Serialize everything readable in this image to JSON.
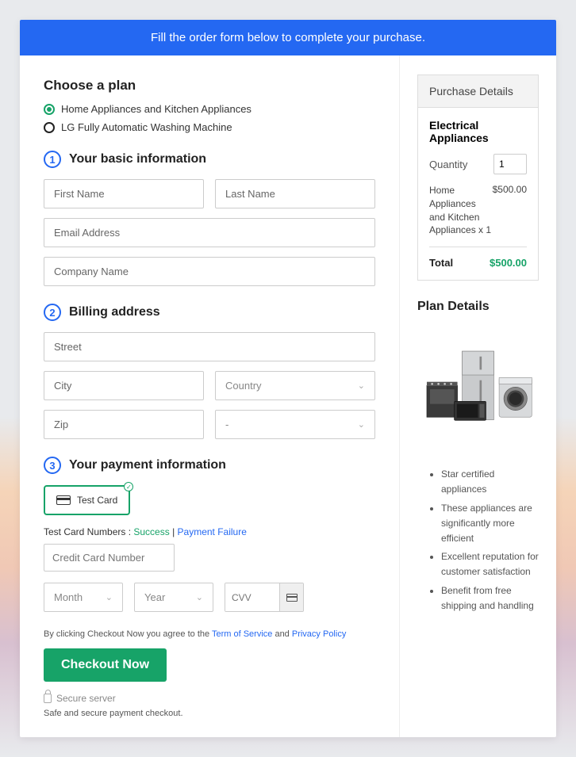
{
  "header": {
    "banner": "Fill the order form below to complete your purchase."
  },
  "plan": {
    "title": "Choose a plan",
    "option1": "Home Appliances and Kitchen Appliances",
    "option2": "LG Fully Automatic Washing Machine"
  },
  "step1": {
    "num": "1",
    "title": "Your basic information",
    "first_name_ph": "First Name",
    "last_name_ph": "Last Name",
    "email_ph": "Email Address",
    "company_ph": "Company Name"
  },
  "step2": {
    "num": "2",
    "title": "Billing address",
    "street_ph": "Street",
    "city_ph": "City",
    "country_label": "Country",
    "zip_ph": "Zip",
    "state_label": "-"
  },
  "step3": {
    "num": "3",
    "title": "Your payment information",
    "chip_label": "Test  Card",
    "test_line_prefix": "Test Card Numbers : ",
    "success": "Success",
    "pipe": " | ",
    "failure": "Payment Failure",
    "cc_ph": "Credit Card Number",
    "month_label": "Month",
    "year_label": "Year",
    "cvv_ph": "CVV"
  },
  "footer": {
    "terms_prefix": "By clicking Checkout Now you agree to the ",
    "tos": "Term of Service",
    "and": " and ",
    "privacy": "Privacy Policy",
    "checkout": "Checkout Now",
    "secure": "Secure server",
    "safe": "Safe and secure payment checkout."
  },
  "purchase": {
    "header": "Purchase Details",
    "category": "Electrical Appliances",
    "qty_label": "Quantity",
    "qty_value": "1",
    "line_desc": "Home Appliances and Kitchen Appliances x 1",
    "line_price": "$500.00",
    "total_label": "Total",
    "total_value": "$500.00"
  },
  "plan_details": {
    "title": "Plan Details",
    "b1": "Star certified appliances",
    "b2": "These appliances are significantly more efficient",
    "b3": "Excellent reputation for customer satisfaction",
    "b4": "Benefit from free shipping and handling"
  }
}
